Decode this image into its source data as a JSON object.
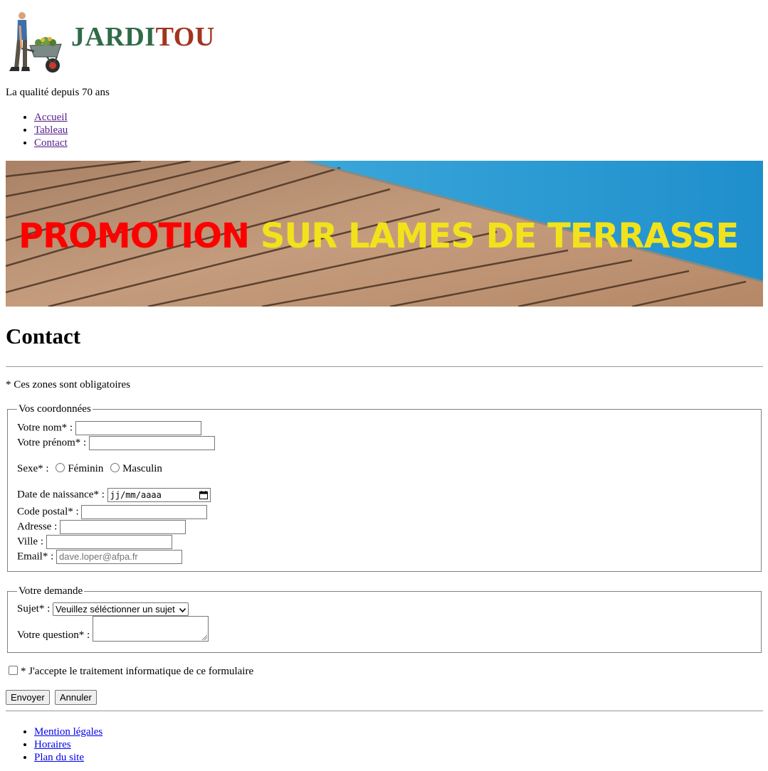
{
  "header": {
    "logo_part1": "JARDI",
    "logo_part2": "TOU",
    "tagline": "La qualité depuis 70 ans"
  },
  "nav": {
    "items": [
      {
        "label": "Accueil"
      },
      {
        "label": "Tableau"
      },
      {
        "label": "Contact"
      }
    ]
  },
  "banner": {
    "word_red": "PROMOTION",
    "words_yellow": "SUR LAMES DE TERRASSE"
  },
  "page": {
    "title": "Contact",
    "required_note": "* Ces zones sont obligatoires"
  },
  "coordonnees": {
    "legend": "Vos coordonnées",
    "nom_label": "Votre nom* :",
    "prenom_label": "Votre prénom* :",
    "sexe_label": "Sexe* :",
    "sexe_options": [
      "Féminin",
      "Masculin"
    ],
    "naissance_label": "Date de naissance* :",
    "naissance_placeholder": "jj/mm/aaaa",
    "cp_label": "Code postal* :",
    "adresse_label": "Adresse :",
    "ville_label": "Ville :",
    "email_label": "Email* :",
    "email_placeholder": "dave.loper@afpa.fr"
  },
  "demande": {
    "legend": "Votre demande",
    "sujet_label": "Sujet* :",
    "sujet_selected": "Veuillez séléctionner un sujet",
    "question_label": "Votre question* :"
  },
  "consent": {
    "label": "* J'accepte le traitement informatique de ce formulaire"
  },
  "buttons": {
    "submit": "Envoyer",
    "reset": "Annuler"
  },
  "footer": {
    "links": [
      {
        "label": "Mention légales"
      },
      {
        "label": "Horaires"
      },
      {
        "label": "Plan du site"
      }
    ]
  },
  "colors": {
    "logo_green": "#2f6b47",
    "logo_red": "#a1351f",
    "promo_red": "#ff0000",
    "promo_yellow": "#f2e21b",
    "pool_blue": "#2a9fd6",
    "deck_wood": "#b88d6c"
  }
}
